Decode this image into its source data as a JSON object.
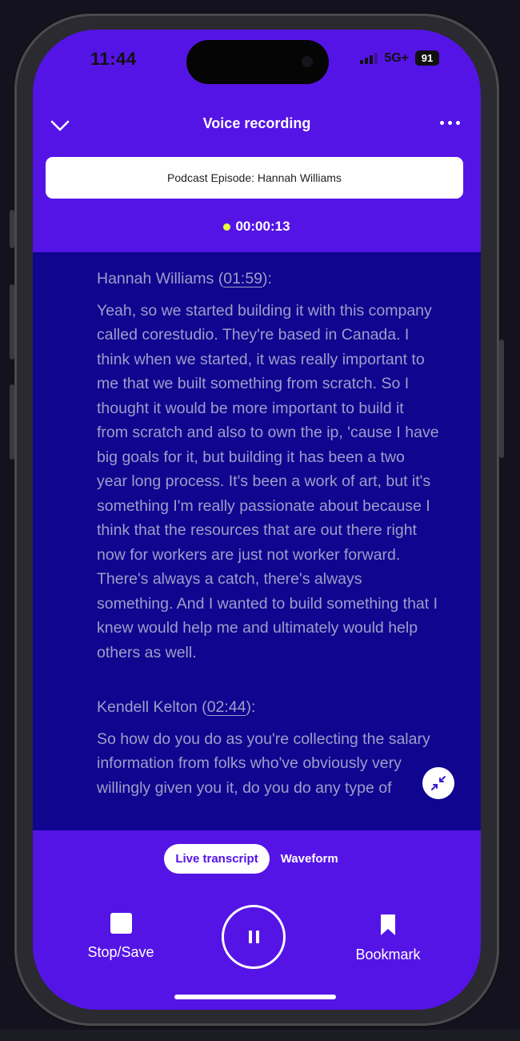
{
  "status": {
    "time": "11:44",
    "network": "5G+",
    "battery": "91"
  },
  "header": {
    "title": "Voice recording",
    "back_icon": "chevron-down-icon",
    "more_icon": "ellipsis-icon"
  },
  "recording": {
    "name": "Podcast Episode: Hannah Williams",
    "elapsed": "00:00:13"
  },
  "transcript": {
    "blocks": [
      {
        "speaker": "Hannah Williams",
        "timestamp": "01:59",
        "text": "Yeah, so we started building it with this company called corestudio. They're based in Canada. I think when we started, it was really important to me that we built something from scratch. So I thought it would be more important to build it from scratch and also to own the ip, 'cause I have big goals for it, but building it has been a two year long process. It's been a work of art, but it's something I'm really passionate about because I think that the resources that are out there right now for workers are just not worker forward. There's always a catch, there's always something. And I wanted to build something that I knew would help me and ultimately would help others as well."
      },
      {
        "speaker": "Kendell Kelton",
        "timestamp": "02:44",
        "text": "So how do you do as you're collecting the salary information from folks who've obviously very willingly given you it, do you do any type of"
      }
    ]
  },
  "view_toggle": {
    "active": "Live transcript",
    "other": "Waveform"
  },
  "controls": {
    "stop_label": "Stop/Save",
    "bookmark_label": "Bookmark"
  },
  "colors": {
    "primary": "#5514e6",
    "transcript_bg": "#10058f",
    "transcript_text": "#9d9ec9",
    "recording_dot": "#e6ff3a"
  }
}
